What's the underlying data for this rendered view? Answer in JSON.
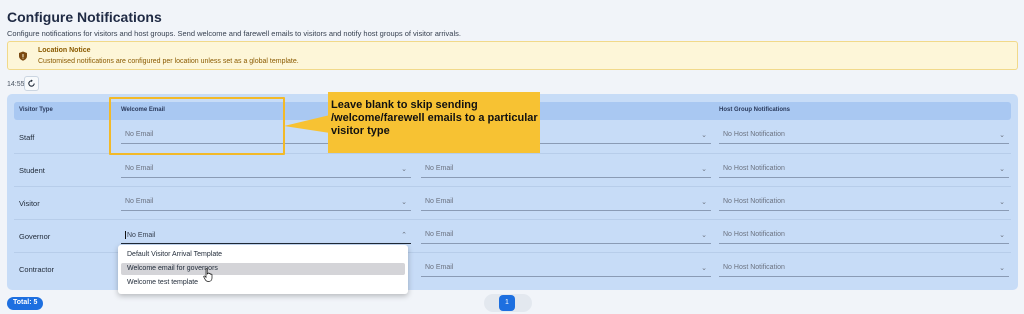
{
  "page": {
    "title": "Configure Notifications",
    "subtitle": "Configure notifications for visitors and host groups. Send welcome and farewell emails to visitors and notify host groups of visitor arrivals."
  },
  "notice": {
    "title": "Location Notice",
    "text": "Customised notifications are configured per location unless set as a global template.",
    "icon": "shield-icon",
    "color": "#8a5a00"
  },
  "toolbar": {
    "time": "14:55",
    "refresh_icon": "refresh-icon"
  },
  "table": {
    "headers": {
      "visitor_type": "Visitor Type",
      "welcome_email": "Welcome Email",
      "host_group": "Host Group Notifications"
    },
    "rows": [
      {
        "type": "Staff",
        "welcome": "No Email",
        "farewell": "",
        "host": "No Host Notification"
      },
      {
        "type": "Student",
        "welcome": "No Email",
        "farewell": "No Email",
        "host": "No Host Notification"
      },
      {
        "type": "Visitor",
        "welcome": "No Email",
        "farewell": "No Email",
        "host": "No Host Notification"
      },
      {
        "type": "Governor",
        "welcome": "No Email",
        "farewell": "No Email",
        "host": "No Host Notification"
      },
      {
        "type": "Contractor",
        "welcome": "",
        "farewell": "No Email",
        "host": "No Host Notification"
      }
    ]
  },
  "dropdown": {
    "options": [
      "Default Visitor Arrival Template",
      "Welcome email for governors",
      "Welcome test template"
    ],
    "highlighted_index": 1
  },
  "callout": {
    "text": "Leave blank to skip sending /welcome/farewell emails to a particular visitor type",
    "color": "#f7c233"
  },
  "footer": {
    "total": "Total: 5",
    "page": "1"
  },
  "colors": {
    "accent": "#1d6fe0",
    "table_bg": "#c7dcf7",
    "header_bg": "#a9c8f2"
  }
}
